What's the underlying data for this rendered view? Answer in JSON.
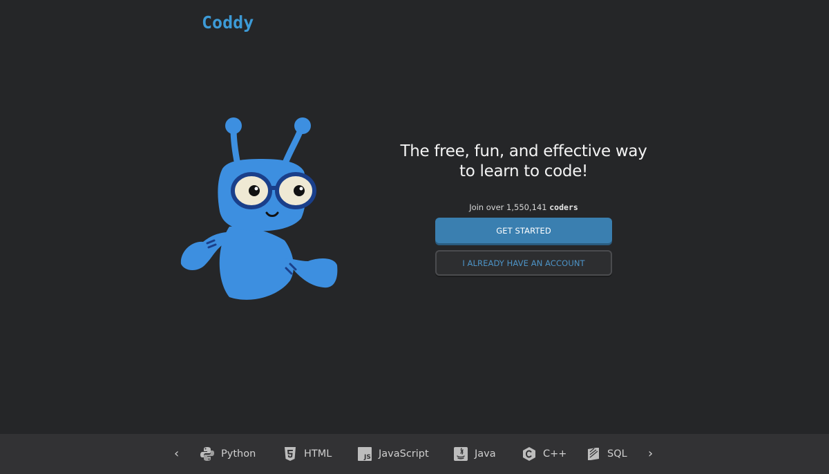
{
  "brand": {
    "logo_text": "Coddy",
    "accent": "#3d9ad6"
  },
  "hero": {
    "headline_line1": "The free, fun, and effective way",
    "headline_line2": "to learn to code!",
    "join_prefix": "Join over 1,550,141",
    "join_suffix": "coders"
  },
  "actions": {
    "get_started": "GET STARTED",
    "have_account": "I ALREADY HAVE AN ACCOUNT"
  },
  "languages": {
    "prev_icon": "chevron-left-icon",
    "next_icon": "chevron-right-icon",
    "items": [
      {
        "label": "Python",
        "icon": "python-icon"
      },
      {
        "label": "HTML",
        "icon": "html5-icon"
      },
      {
        "label": "JavaScript",
        "icon": "javascript-icon"
      },
      {
        "label": "Java",
        "icon": "java-icon"
      },
      {
        "label": "C++",
        "icon": "cplusplus-icon"
      },
      {
        "label": "SQL",
        "icon": "sql-icon"
      }
    ]
  },
  "colors": {
    "background": "#252628",
    "primary_button": "#3a7fb0",
    "secondary_text": "#4d94c7",
    "mascot": "#3d8fe0"
  }
}
